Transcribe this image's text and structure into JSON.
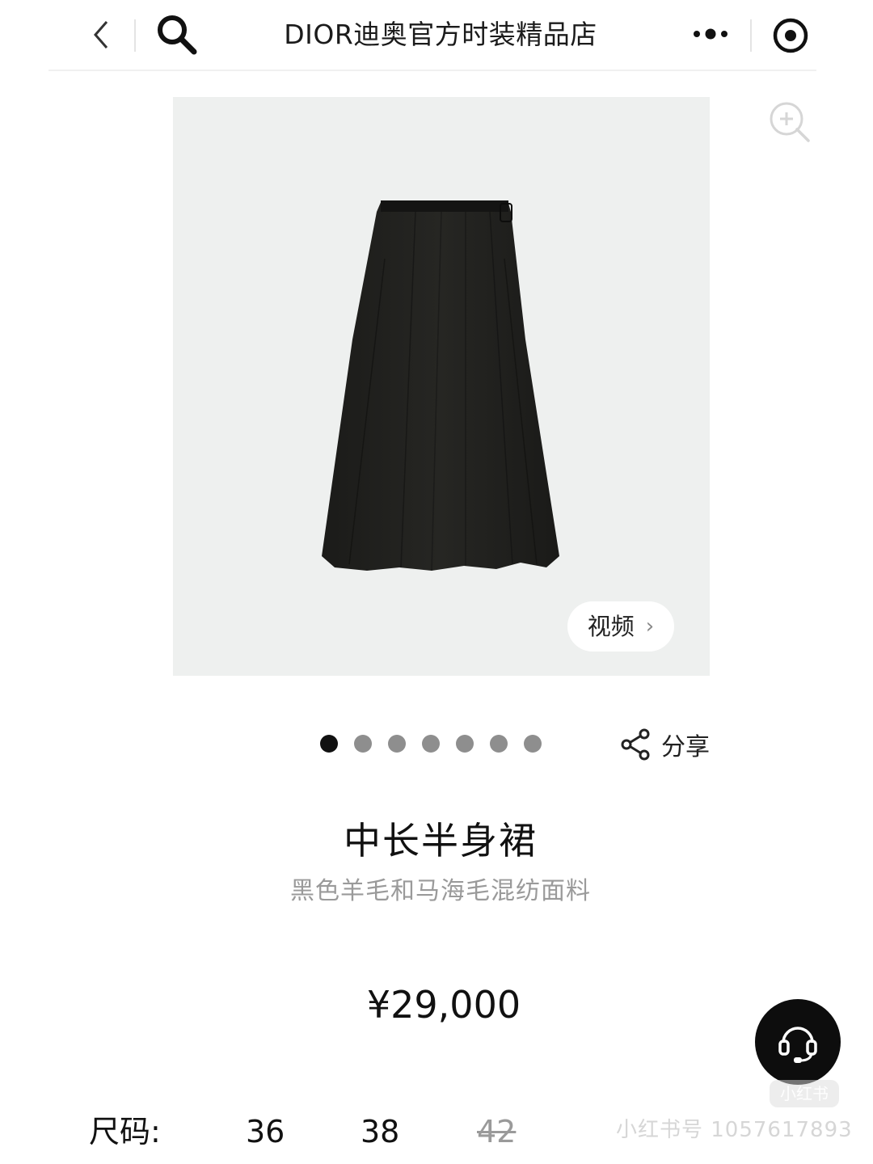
{
  "header": {
    "title": "DIOR迪奥官方时装精品店",
    "back_icon": "chevron-left-icon",
    "search_icon": "search-icon",
    "more_icon": "more-dots-icon",
    "close_icon": "target-icon"
  },
  "gallery": {
    "video_label": "视频",
    "image_count": 7,
    "active_index": 0,
    "zoom_icon": "zoom-in-icon"
  },
  "share": {
    "label": "分享",
    "icon": "share-icon"
  },
  "product": {
    "name": "中长半身裙",
    "description": "黑色羊毛和马海毛混纺面料",
    "price": "¥29,000"
  },
  "sizes": {
    "label": "尺码:",
    "options": [
      {
        "value": "36",
        "available": true
      },
      {
        "value": "38",
        "available": true
      },
      {
        "value": "42",
        "available": false
      }
    ]
  },
  "service": {
    "icon": "headset-icon"
  },
  "watermark": {
    "badge": "小红书",
    "text": "小红书号 1057617893"
  },
  "colors": {
    "background": "#ffffff",
    "image_bg": "#eef0ef",
    "skirt": "#1f1f1c",
    "dot_inactive": "#8e8e8e",
    "dot_active": "#111111",
    "muted_text": "#9a9a9a",
    "service_bg": "#0d0d0d"
  }
}
